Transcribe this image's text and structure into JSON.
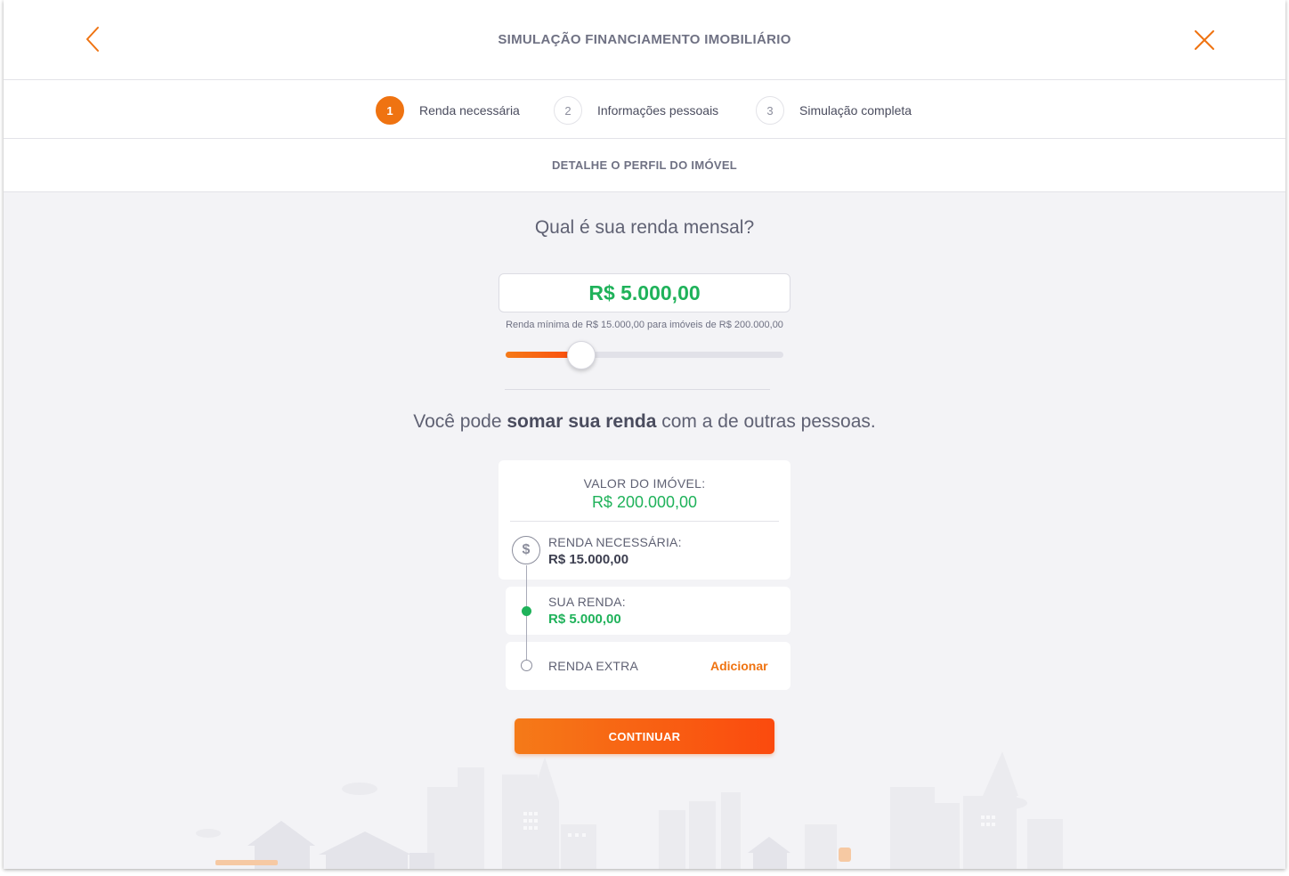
{
  "header": {
    "title": "SIMULAÇÃO FINANCIAMENTO IMOBILIÁRIO"
  },
  "steps": [
    {
      "number": "1",
      "label": "Renda necessária",
      "active": true
    },
    {
      "number": "2",
      "label": "Informações pessoais",
      "active": false
    },
    {
      "number": "3",
      "label": "Simulação completa",
      "active": false
    }
  ],
  "subheader": {
    "title": "DETALHE O PERFIL DO IMÓVEL"
  },
  "income": {
    "question": "Qual é sua renda mensal?",
    "value": "R$ 5.000,00",
    "hint": "Renda mínima de R$ 15.000,00 para imóveis de R$ 200.000,00",
    "slider_fraction": 0.27
  },
  "sum_text": {
    "prefix": "Você pode ",
    "bold": "somar sua renda",
    "suffix": " com a de outras pessoas."
  },
  "summary": {
    "property_label": "VALOR DO IMÓVEL:",
    "property_value": "R$ 200.000,00",
    "required_label": "RENDA NECESSÁRIA:",
    "required_value": "R$ 15.000,00",
    "your_income_label": "SUA RENDA:",
    "your_income_value": "R$ 5.000,00",
    "extra_label": "RENDA EXTRA",
    "add_label": "Adicionar"
  },
  "actions": {
    "continue_label": "CONTINUAR"
  },
  "icons": {
    "back": "chevron-left-icon",
    "close": "close-icon",
    "dollar": "dollar-icon"
  },
  "colors": {
    "accent": "#ef7311",
    "money_green": "#1fb25a",
    "background": "#f3f3f6"
  }
}
